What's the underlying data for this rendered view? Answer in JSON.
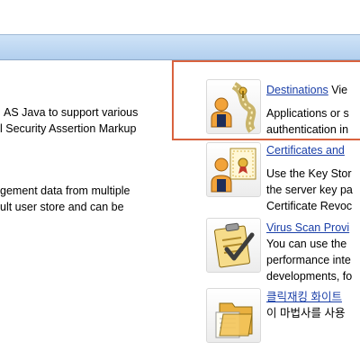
{
  "left_panel": {
    "block1": [
      "AS Java to support various",
      "l Security Assertion Markup"
    ],
    "block2": [
      "gement data from multiple",
      "ult user store and can be"
    ]
  },
  "items": [
    {
      "title": "Destinations",
      "suffix": "Vie",
      "lines": [
        "Applications or s",
        "authentication in"
      ]
    },
    {
      "title": "Certificates and",
      "suffix": "",
      "lines": [
        "Use the Key Stor",
        "the server key pa",
        "Certificate Revoc"
      ]
    },
    {
      "title": "Virus Scan Provi",
      "suffix": "",
      "lines": [
        "You can use the",
        "performance inte",
        "developments, fo"
      ]
    },
    {
      "title": "클릭재킹 화이트",
      "suffix": "",
      "lines": [
        "이 마법사를 사용"
      ]
    }
  ],
  "icons": [
    "destinations-icon",
    "certificate-icon",
    "virus-scan-icon",
    "folder-icon"
  ],
  "colors": {
    "banner": "#bcd6f1",
    "link": "#1a3fa8",
    "highlight": "#d9623e"
  }
}
